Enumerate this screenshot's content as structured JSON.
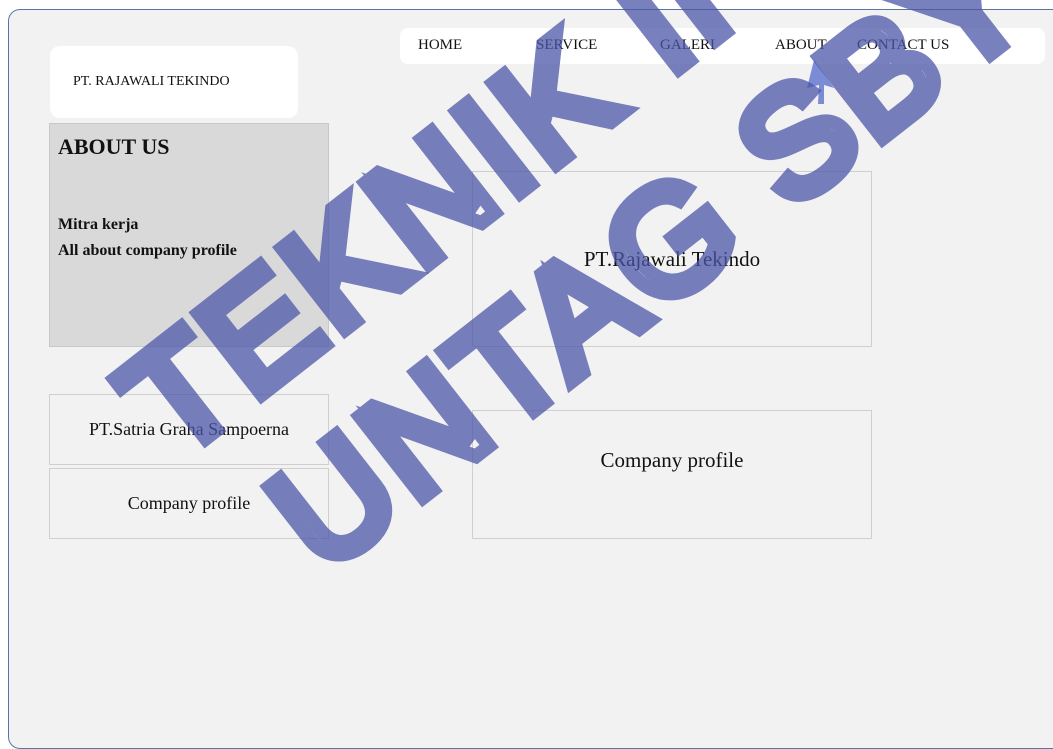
{
  "logo": {
    "text": "PT. RAJAWALI TEKINDO"
  },
  "nav": {
    "items": [
      {
        "label": "HOME"
      },
      {
        "label": "SERVICE"
      },
      {
        "label": "GALERI"
      },
      {
        "label": "ABOUT"
      },
      {
        "label": "CONTACT US"
      }
    ]
  },
  "about_panel": {
    "title": "ABOUT US",
    "links": [
      "Mitra kerja",
      "All about company profile"
    ]
  },
  "left_cards": [
    "PT.Satria Graha Sampoerna",
    "Company profile"
  ],
  "right_cards": [
    "PT.Rajawali Tekindo",
    "Company profile"
  ],
  "watermark": {
    "lines": [
      "TEKNIK IF",
      "UNTAG SBY"
    ],
    "color": "#4b55a8"
  },
  "colors": {
    "background": "#f2f2f2",
    "frame_border": "#5a74a8",
    "panel": "#d9d9d9",
    "cursor": "#7b8bd6"
  }
}
